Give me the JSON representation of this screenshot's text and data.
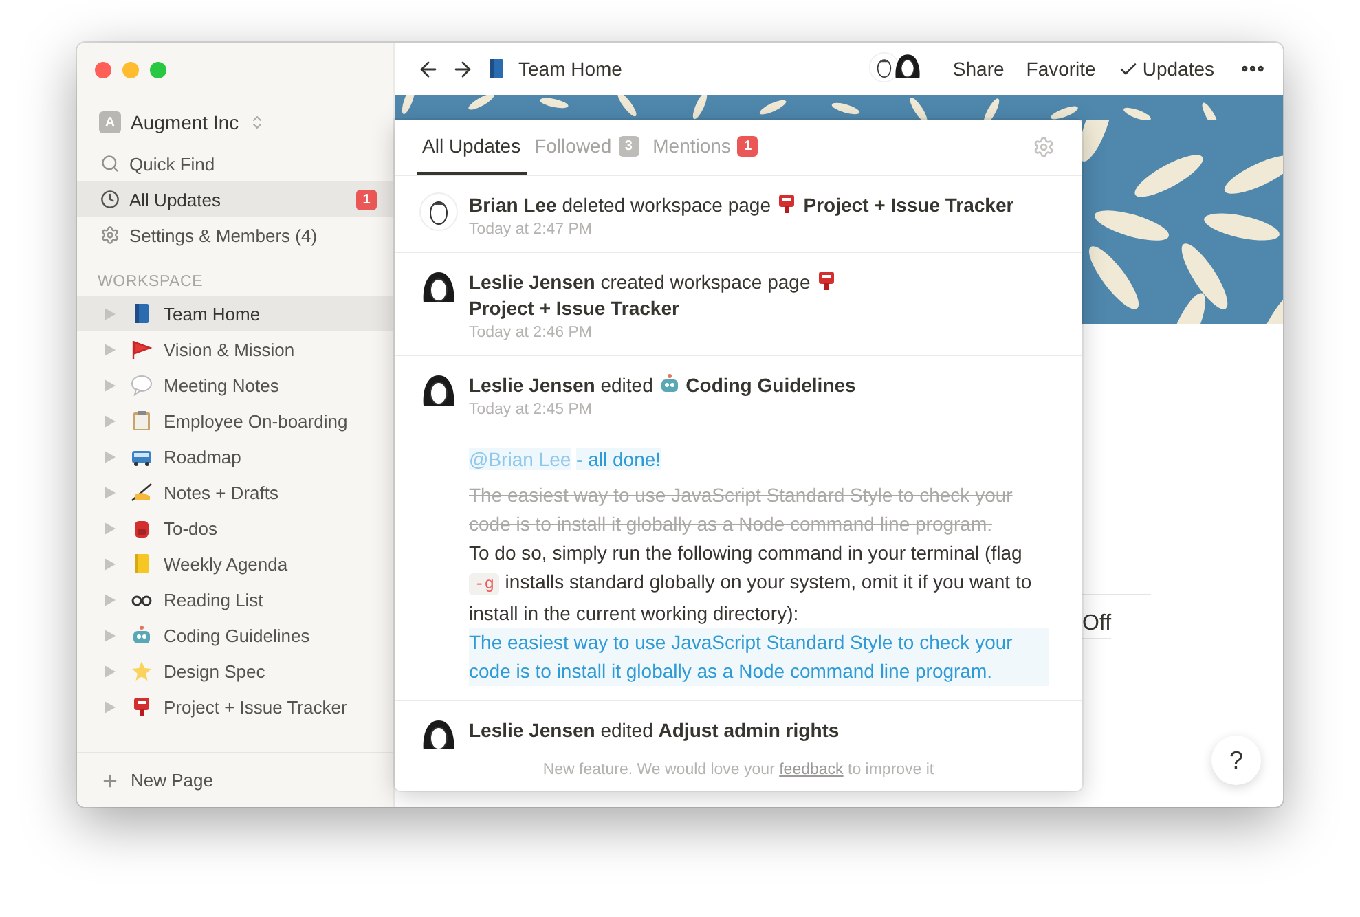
{
  "sidebar": {
    "workspace": {
      "initial": "A",
      "name": "Augment Inc"
    },
    "nav": [
      {
        "kind": "search",
        "label": "Quick Find",
        "selected": false
      },
      {
        "kind": "updates",
        "label": "All Updates",
        "selected": true,
        "badge": "1"
      },
      {
        "kind": "settings",
        "label": "Settings & Members (4)",
        "selected": false
      }
    ],
    "section_title": "WORKSPACE",
    "pages": [
      {
        "label": "Team Home",
        "selected": true
      },
      {
        "label": "Vision & Mission",
        "selected": false
      },
      {
        "label": "Meeting Notes",
        "selected": false
      },
      {
        "label": "Employee On-boarding",
        "selected": false
      },
      {
        "label": "Roadmap",
        "selected": false
      },
      {
        "label": "Notes + Drafts",
        "selected": false
      },
      {
        "label": "To-dos",
        "selected": false
      },
      {
        "label": "Weekly Agenda",
        "selected": false
      },
      {
        "label": "Reading List",
        "selected": false
      },
      {
        "label": "Coding Guidelines",
        "selected": false
      },
      {
        "label": "Design Spec",
        "selected": false
      },
      {
        "label": "Project + Issue Tracker",
        "selected": false
      }
    ],
    "new_page": "New Page"
  },
  "topbar": {
    "page_title": "Team Home",
    "actions": [
      {
        "kind": "plain",
        "label": "Share"
      },
      {
        "kind": "plain",
        "label": "Favorite"
      },
      {
        "kind": "checked",
        "label": "Updates"
      }
    ]
  },
  "page": {
    "visible_text": "Off"
  },
  "help_button": "?",
  "updates_panel": {
    "tabs": [
      {
        "label": "All Updates",
        "selected": true
      },
      {
        "label": "Followed",
        "selected": false,
        "count": "3",
        "kind": "neutral"
      },
      {
        "label": "Mentions",
        "selected": false,
        "count": "1",
        "kind": "alert"
      }
    ],
    "entries": [
      {
        "kind": "man",
        "text": "**Brian Lee** deleted workspace page",
        "page": "Project + Issue Tracker",
        "time": "Today at 2:47 PM"
      },
      {
        "kind": "woman",
        "text": "**Leslie Jensen** created workspace page",
        "page": "Project + Issue Tracker",
        "time": "Today at 2:46 PM"
      },
      {
        "kind": "woman",
        "text": "**Leslie Jensen** edited",
        "page": "Coding Guidelines",
        "time": "Today at 2:45 PM",
        "comment": {
          "mention": "@Brian Lee",
          "note": "- all done!",
          "struck": "The easiest way to use JavaScript Standard Style to check your code is to install it globally as a Node command line program.",
          "plain_before": "To do so, simply run the following command in your terminal (flag",
          "code": "-g",
          "plain_after": "installs standard globally on your system, omit it if you want to install in the current working directory):",
          "highlighted": "The easiest way to use JavaScript Standard Style to check your code is to install it globally as a Node command line program."
        }
      },
      {
        "kind": "woman",
        "text": "**Leslie Jensen** edited",
        "page": "Adjust admin rights"
      }
    ],
    "footer": {
      "before": "New feature. We would love your",
      "link": "feedback",
      "after": "to improve it"
    }
  }
}
